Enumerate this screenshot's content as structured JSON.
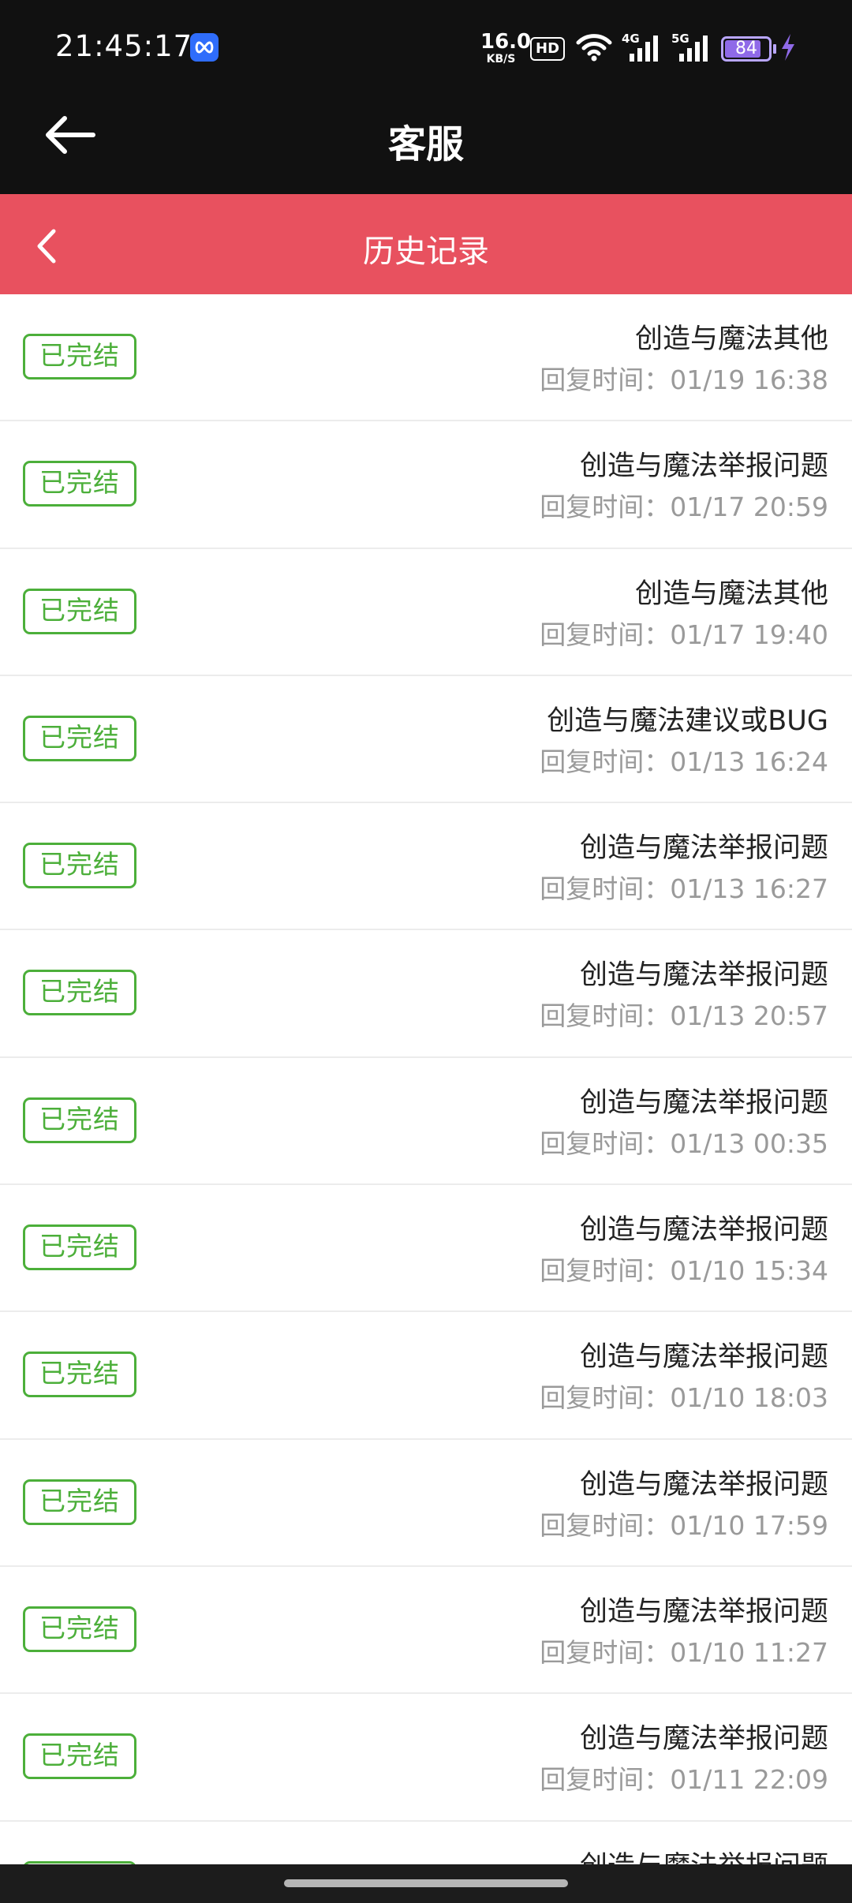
{
  "status_bar": {
    "time": "21:45:17",
    "app_icon": "infinity-app-icon",
    "net_speed_value": "16.0",
    "net_speed_unit": "KB/S",
    "hd_badge": "HD",
    "signal_1_tag": "4G",
    "signal_2_tag": "5G",
    "battery_level": "84",
    "charging": true,
    "colors": {
      "battery": "#8f6ae8",
      "app_icon_bg": "#2f6dfb"
    }
  },
  "header": {
    "title": "客服",
    "back_icon": "arrow-left-icon",
    "background": "#111111"
  },
  "sub_header": {
    "title": "历史记录",
    "back_icon": "chevron-left-icon",
    "background": "#e8515f"
  },
  "tickets": [
    {
      "status": "已完结",
      "title": "创造与魔法其他",
      "reply_time": "回复时间：01/19 16:38"
    },
    {
      "status": "已完结",
      "title": "创造与魔法举报问题",
      "reply_time": "回复时间：01/17 20:59"
    },
    {
      "status": "已完结",
      "title": "创造与魔法其他",
      "reply_time": "回复时间：01/17 19:40"
    },
    {
      "status": "已完结",
      "title": "创造与魔法建议或BUG",
      "reply_time": "回复时间：01/13 16:24"
    },
    {
      "status": "已完结",
      "title": "创造与魔法举报问题",
      "reply_time": "回复时间：01/13 16:27"
    },
    {
      "status": "已完结",
      "title": "创造与魔法举报问题",
      "reply_time": "回复时间：01/13 20:57"
    },
    {
      "status": "已完结",
      "title": "创造与魔法举报问题",
      "reply_time": "回复时间：01/13 00:35"
    },
    {
      "status": "已完结",
      "title": "创造与魔法举报问题",
      "reply_time": "回复时间：01/10 15:34"
    },
    {
      "status": "已完结",
      "title": "创造与魔法举报问题",
      "reply_time": "回复时间：01/10 18:03"
    },
    {
      "status": "已完结",
      "title": "创造与魔法举报问题",
      "reply_time": "回复时间：01/10 17:59"
    },
    {
      "status": "已完结",
      "title": "创造与魔法举报问题",
      "reply_time": "回复时间：01/10 11:27"
    },
    {
      "status": "已完结",
      "title": "创造与魔法举报问题",
      "reply_time": "回复时间：01/11 22:09"
    },
    {
      "status": "已完结",
      "title": "创造与魔法举报问题",
      "reply_time": ""
    }
  ],
  "colors": {
    "status_badge": "#4caf3a",
    "time_text": "#9a9a9a",
    "title_text": "#222222"
  }
}
